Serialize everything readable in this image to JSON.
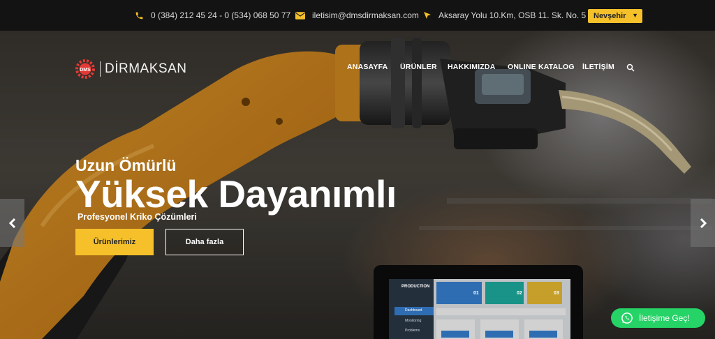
{
  "topbar": {
    "phone": "0 (384) 212 45 24 - 0 (534) 068 50 77",
    "email": "iletisim@dmsdirmaksan.com",
    "address": "Aksaray Yolu 10.Km, OSB 11. Sk. No. 5",
    "city": "Nevşehir"
  },
  "logo": {
    "mark": "DMS",
    "name": "DİRMAKSAN"
  },
  "nav": {
    "items": [
      "ANASAYFA",
      "ÜRÜNLER",
      "HAKKIMIZDA",
      "ONLINE KATALOG",
      "İLETİŞİM"
    ]
  },
  "hero": {
    "subtitle": "Uzun Ömürlü",
    "title": "Yüksek Dayanımlı",
    "description": "Profesyonel Kriko Çözümleri",
    "primary_button": "Ürünlerimiz",
    "secondary_button": "Daha fazla"
  },
  "tablet": {
    "brand": "PRODUCTION",
    "menu": [
      "Dashboard",
      "Monitoring",
      "Problems"
    ],
    "cards": [
      "01",
      "02",
      "03"
    ]
  },
  "whatsapp": {
    "label": "İletişime Geç!"
  },
  "colors": {
    "accent": "#f5c02a",
    "whatsapp": "#25d366",
    "topbar": "#131313"
  },
  "icons": [
    "phone-icon",
    "envelope-icon",
    "location-arrow-icon",
    "search-icon",
    "chevron-left-icon",
    "chevron-right-icon",
    "whatsapp-icon"
  ]
}
